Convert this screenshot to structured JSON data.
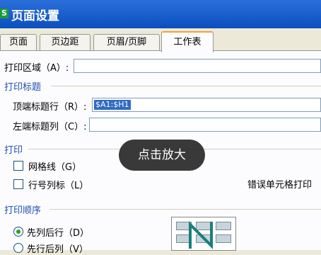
{
  "dialog": {
    "title": "页面设置",
    "app_icon": "S"
  },
  "tabs": [
    {
      "label": "页面"
    },
    {
      "label": "页边距"
    },
    {
      "label": "页眉/页脚"
    },
    {
      "label": "工作表",
      "active": true
    }
  ],
  "print_area": {
    "label": "打印区域（A）:",
    "value": ""
  },
  "print_titles": {
    "section": "打印标题",
    "top_rows": {
      "label": "顶端标题行（R）:",
      "value": "$A1:$H1"
    },
    "left_cols": {
      "label": "左端标题列（C）:",
      "value": ""
    }
  },
  "print": {
    "section": "打印",
    "gridlines": {
      "label": "网格线（G）",
      "checked": false
    },
    "row_col_headers": {
      "label": "行号列标（L）",
      "checked": false
    },
    "cell_errors_label": "错误单元格打印"
  },
  "print_order": {
    "section": "打印顺序",
    "options": [
      {
        "label": "先列后行（D）",
        "selected": true
      },
      {
        "label": "先行后列（V）",
        "selected": false
      }
    ]
  },
  "overlay": {
    "zoom_label": "点击放大"
  },
  "colors": {
    "titlebar": "#0b4fbf",
    "section": "#1f4fb0",
    "selection": "#316ac5",
    "tab_highlight": "#f1a334"
  }
}
